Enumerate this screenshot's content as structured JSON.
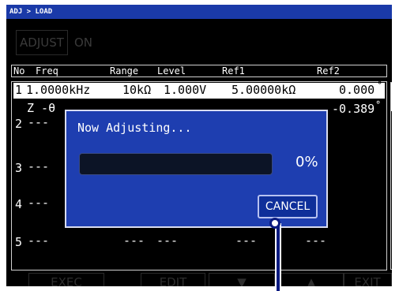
{
  "breadcrumb": "ADJ > LOAD",
  "adjust": {
    "button_label": "ADJUST",
    "state": "ON"
  },
  "table": {
    "headers": [
      "No",
      "Freq",
      "Range",
      "Level",
      "Ref1",
      "Ref2"
    ],
    "selected_row": {
      "no": "1",
      "freq": "1.0000kHz",
      "range": "10kΩ",
      "level": "1.000V",
      "ref1": "5.00000kΩ",
      "ref2": "0.000",
      "ref2_unit": "°"
    },
    "sub_row": {
      "label": "Z -θ",
      "value": "-0.389",
      "unit": "°"
    },
    "rows": [
      {
        "no": "2",
        "freq": "---"
      },
      {
        "no": "3",
        "freq": "---"
      },
      {
        "no": "4",
        "freq": "---"
      },
      {
        "no": "5",
        "freq": "---",
        "range": "---",
        "level": "---",
        "ref1": "---",
        "ref2": "---"
      }
    ]
  },
  "footer": {
    "buttons": [
      "EXEC",
      "EDIT",
      "▼",
      "▲",
      "EXIT"
    ]
  },
  "dialog": {
    "title": "Now Adjusting...",
    "progress_value": 0,
    "progress_label": "0%",
    "cancel_label": "CANCEL"
  },
  "colors": {
    "screen_bg": "#000000",
    "header_bar": "#1a3aa8",
    "dialog_bg": "#1e3eb0",
    "cancel_bg": "#0f2f9a",
    "disabled_text": "#3a3a3a"
  }
}
